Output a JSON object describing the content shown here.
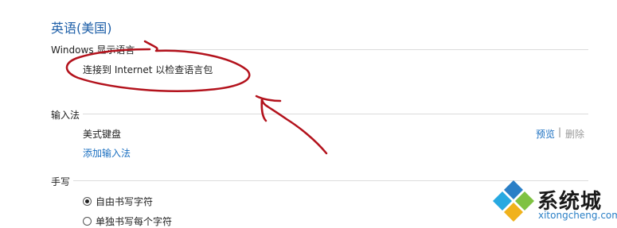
{
  "page": {
    "title": "英语(美国)"
  },
  "display_language": {
    "heading": "Windows 显示语言",
    "status": "连接到 Internet 以检查语言包"
  },
  "input_method": {
    "heading": "输入法",
    "keyboard": "美式键盘",
    "preview_link": "预览",
    "separator": "|",
    "delete_link": "删除",
    "add_link": "添加输入法"
  },
  "handwriting": {
    "heading": "手写",
    "options": [
      {
        "label": "自由书写字符",
        "selected": true
      },
      {
        "label": "单独书写每个字符",
        "selected": false
      }
    ]
  },
  "watermark": {
    "brand": "系统城",
    "url": "xitongcheng.com"
  },
  "colors": {
    "title_blue": "#1e5fa8",
    "link_blue": "#1a6fc0",
    "annotation_red": "#b3121c"
  }
}
